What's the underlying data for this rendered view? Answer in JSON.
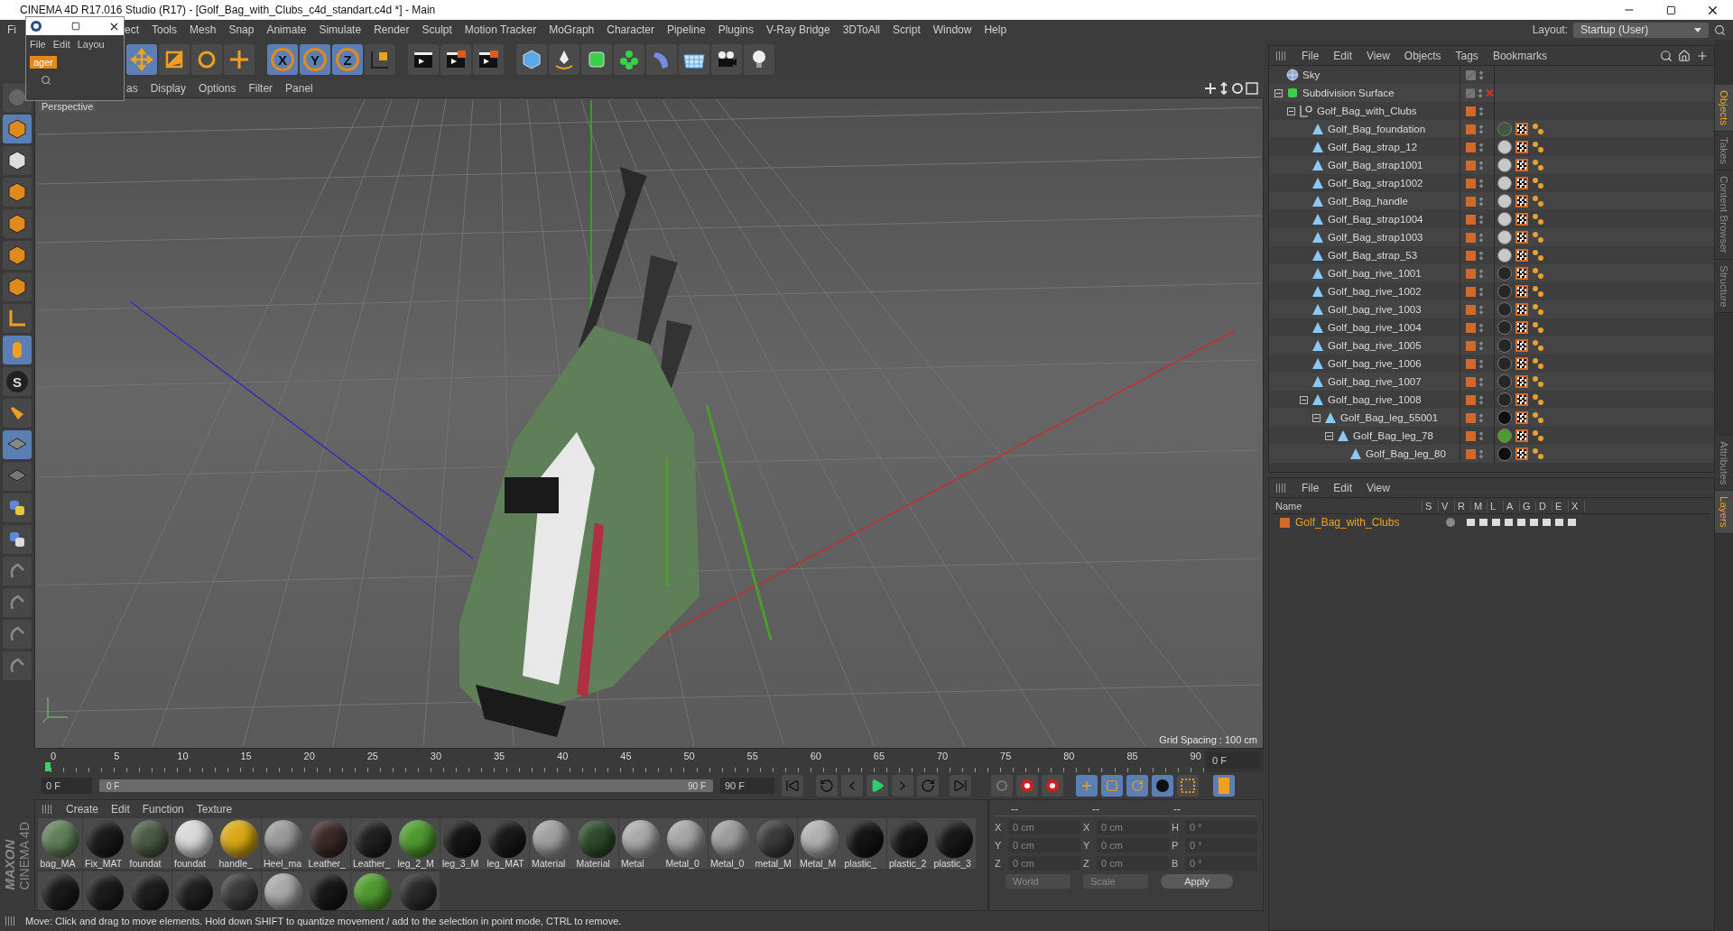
{
  "title_bar": {
    "title": "CINEMA 4D R17.016 Studio (R17) - [Golf_Bag_with_Clubs_c4d_standart.c4d *] - Main"
  },
  "floating_window": {
    "menu": [
      "File",
      "Edit",
      "Layou"
    ],
    "tab_label": "ager"
  },
  "menu_bar": {
    "items": [
      "Fi",
      "ect",
      "Tools",
      "Mesh",
      "Snap",
      "Animate",
      "Simulate",
      "Render",
      "Sculpt",
      "Motion Tracker",
      "MoGraph",
      "Character",
      "Pipeline",
      "Plugins",
      "V-Ray Bridge",
      "3DToAll",
      "Script",
      "Window",
      "Help"
    ],
    "layout_label": "Layout:",
    "layout_value": "Startup (User)"
  },
  "toolbar": {
    "axis_locks": [
      "X",
      "Y",
      "Z"
    ]
  },
  "left_toolbar": {
    "snap_label": "S"
  },
  "viewport": {
    "menu": [
      "as",
      "Display",
      "Options",
      "Filter",
      "Panel"
    ],
    "camera_label": "Perspective",
    "grid_spacing": "Grid Spacing : 100 cm"
  },
  "timeline": {
    "ruler_labels": [
      "0",
      "5",
      "10",
      "15",
      "20",
      "25",
      "30",
      "35",
      "40",
      "45",
      "50",
      "55",
      "60",
      "65",
      "70",
      "75",
      "80",
      "85",
      "90"
    ],
    "current_frame": "0 F",
    "start_field": "0 F",
    "range": {
      "start": "0 F",
      "end": "90 F",
      "level": 1
    },
    "end_field": "90 F"
  },
  "material_manager": {
    "menu": [
      "Create",
      "Edit",
      "Function",
      "Texture"
    ],
    "materials": [
      {
        "name": "bag_MA",
        "color": "#5f7f58"
      },
      {
        "name": "Fix_MAT",
        "color": "#1a1a1a"
      },
      {
        "name": "foundat",
        "color": "#4a5a44"
      },
      {
        "name": "foundat",
        "color": "#d8d8d8"
      },
      {
        "name": "handle_",
        "color": "#d9a814"
      },
      {
        "name": "Heel_ma",
        "color": "#9a9a9a"
      },
      {
        "name": "Leather_",
        "color": "#3a2a28"
      },
      {
        "name": "Leather_",
        "color": "#202020"
      },
      {
        "name": "leg_2_M",
        "color": "#4f9a2e"
      },
      {
        "name": "leg_3_M",
        "color": "#151515"
      },
      {
        "name": "leg_MAT",
        "color": "#181818"
      },
      {
        "name": "Material",
        "color": "#a0a0a0"
      },
      {
        "name": "Material",
        "color": "#2e4a2a"
      },
      {
        "name": "Metal",
        "color": "#aaaaaa"
      },
      {
        "name": "Metal_0",
        "color": "#a5a5a5"
      },
      {
        "name": "Metal_0",
        "color": "#9c9c9c"
      },
      {
        "name": "metal_M",
        "color": "#3a3a3a"
      },
      {
        "name": "Metal_M",
        "color": "#b0b0b0"
      },
      {
        "name": "plastic_",
        "color": "#141414"
      },
      {
        "name": "plastic_2",
        "color": "#161616"
      },
      {
        "name": "plastic_3",
        "color": "#181818"
      }
    ],
    "materials_row_2": [
      {
        "color": "#1a1a1a"
      },
      {
        "color": "#1c1c1c"
      },
      {
        "color": "#1e1e1e"
      },
      {
        "color": "#202020"
      },
      {
        "color": "#3a3a3a"
      },
      {
        "color": "#a8a8a8"
      },
      {
        "color": "#171717"
      },
      {
        "color": "#4f9a2e"
      },
      {
        "color": "#2a2a2a"
      }
    ]
  },
  "logo": {
    "brand": "MAXON",
    "product": "CINEMA 4D"
  },
  "coordinates": {
    "headers": [
      "--",
      "--",
      "--"
    ],
    "rows": [
      {
        "position_axis": "X",
        "position": "0 cm",
        "size_axis": "X",
        "size": "0 cm",
        "rotation_axis": "H",
        "rotation": "0 °"
      },
      {
        "position_axis": "Y",
        "position": "0 cm",
        "size_axis": "Y",
        "size": "0 cm",
        "rotation_axis": "P",
        "rotation": "0 °"
      },
      {
        "position_axis": "Z",
        "position": "0 cm",
        "size_axis": "Z",
        "size": "0 cm",
        "rotation_axis": "B",
        "rotation": "0 °"
      }
    ],
    "mode": "World",
    "transform": "Scale",
    "apply": "Apply"
  },
  "status_bar": {
    "text": "Move: Click and drag to move elements. Hold down SHIFT to quantize movement / add to the selection in point mode, CTRL to remove."
  },
  "object_manager": {
    "menu": [
      "File",
      "Edit",
      "View",
      "Objects",
      "Tags",
      "Bookmarks"
    ],
    "objects": [
      {
        "name": "Sky",
        "kind": "sky",
        "enabled": true
      },
      {
        "name": "Subdivision Surface",
        "kind": "subdivision",
        "enabled": false,
        "expanded": true,
        "children": [
          {
            "name": "Golf_Bag_with_Clubs",
            "kind": "null",
            "enabled": true,
            "expanded": true,
            "children": [
              {
                "name": "Golf_Bag_foundation",
                "kind": "polygon",
                "enabled": true,
                "color": "#3f5a3a"
              },
              {
                "name": "Golf_Bag_strap_12",
                "kind": "polygon",
                "enabled": true,
                "color": "#c8c8c8"
              },
              {
                "name": "Golf_Bag_strap1001",
                "kind": "polygon",
                "enabled": true,
                "color": "#c8c8c8"
              },
              {
                "name": "Golf_Bag_strap1002",
                "kind": "polygon",
                "enabled": true,
                "color": "#c8c8c8"
              },
              {
                "name": "Golf_Bag_handle",
                "kind": "polygon",
                "enabled": true,
                "color": "#c8c8c8"
              },
              {
                "name": "Golf_Bag_strap1004",
                "kind": "polygon",
                "enabled": true,
                "color": "#c8c8c8"
              },
              {
                "name": "Golf_Bag_strap1003",
                "kind": "polygon",
                "enabled": true,
                "color": "#c8c8c8"
              },
              {
                "name": "Golf_Bag_strap_53",
                "kind": "polygon",
                "enabled": true,
                "color": "#c8c8c8"
              },
              {
                "name": "Golf_bag_rive_1001",
                "kind": "polygon",
                "enabled": true,
                "color": "#262626"
              },
              {
                "name": "Golf_bag_rive_1002",
                "kind": "polygon",
                "enabled": true,
                "color": "#262626"
              },
              {
                "name": "Golf_bag_rive_1003",
                "kind": "polygon",
                "enabled": true,
                "color": "#262626"
              },
              {
                "name": "Golf_bag_rive_1004",
                "kind": "polygon",
                "enabled": true,
                "color": "#262626"
              },
              {
                "name": "Golf_bag_rive_1005",
                "kind": "polygon",
                "enabled": true,
                "color": "#262626"
              },
              {
                "name": "Golf_bag_rive_1006",
                "kind": "polygon",
                "enabled": true,
                "color": "#262626"
              },
              {
                "name": "Golf_bag_rive_1007",
                "kind": "polygon",
                "enabled": true,
                "color": "#262626"
              },
              {
                "name": "Golf_bag_rive_1008",
                "kind": "polygon",
                "enabled": true,
                "color": "#262626",
                "expanded": true,
                "children": [
                  {
                    "name": "Golf_Bag_leg_55001",
                    "kind": "polygon",
                    "enabled": true,
                    "color": "#0e0e0e",
                    "expanded": true,
                    "children": [
                      {
                        "name": "Golf_Bag_leg_78",
                        "kind": "polygon",
                        "enabled": true,
                        "color": "#4f9a2e",
                        "expanded": true,
                        "children": [
                          {
                            "name": "Golf_Bag_leg_80",
                            "kind": "polygon",
                            "enabled": true,
                            "color": "#0e0e0e"
                          }
                        ]
                      }
                    ]
                  }
                ]
              }
            ]
          }
        ]
      }
    ]
  },
  "layer_manager": {
    "menu": [
      "File",
      "Edit",
      "View"
    ],
    "columns": [
      "Name",
      "S",
      "V",
      "R",
      "M",
      "L",
      "A",
      "G",
      "D",
      "E",
      "X"
    ],
    "rows": [
      {
        "name": "Golf_Bag_with_Clubs",
        "color": "#d0692a"
      }
    ]
  },
  "side_tabs": {
    "top": [
      {
        "label": "Objects",
        "selected": true
      },
      {
        "label": "Takes",
        "selected": false
      },
      {
        "label": "Content Browser",
        "selected": false
      },
      {
        "label": "Structure",
        "selected": false
      }
    ],
    "bottom": [
      {
        "label": "Attributes",
        "selected": false
      },
      {
        "label": "Layers",
        "selected": true
      }
    ]
  }
}
